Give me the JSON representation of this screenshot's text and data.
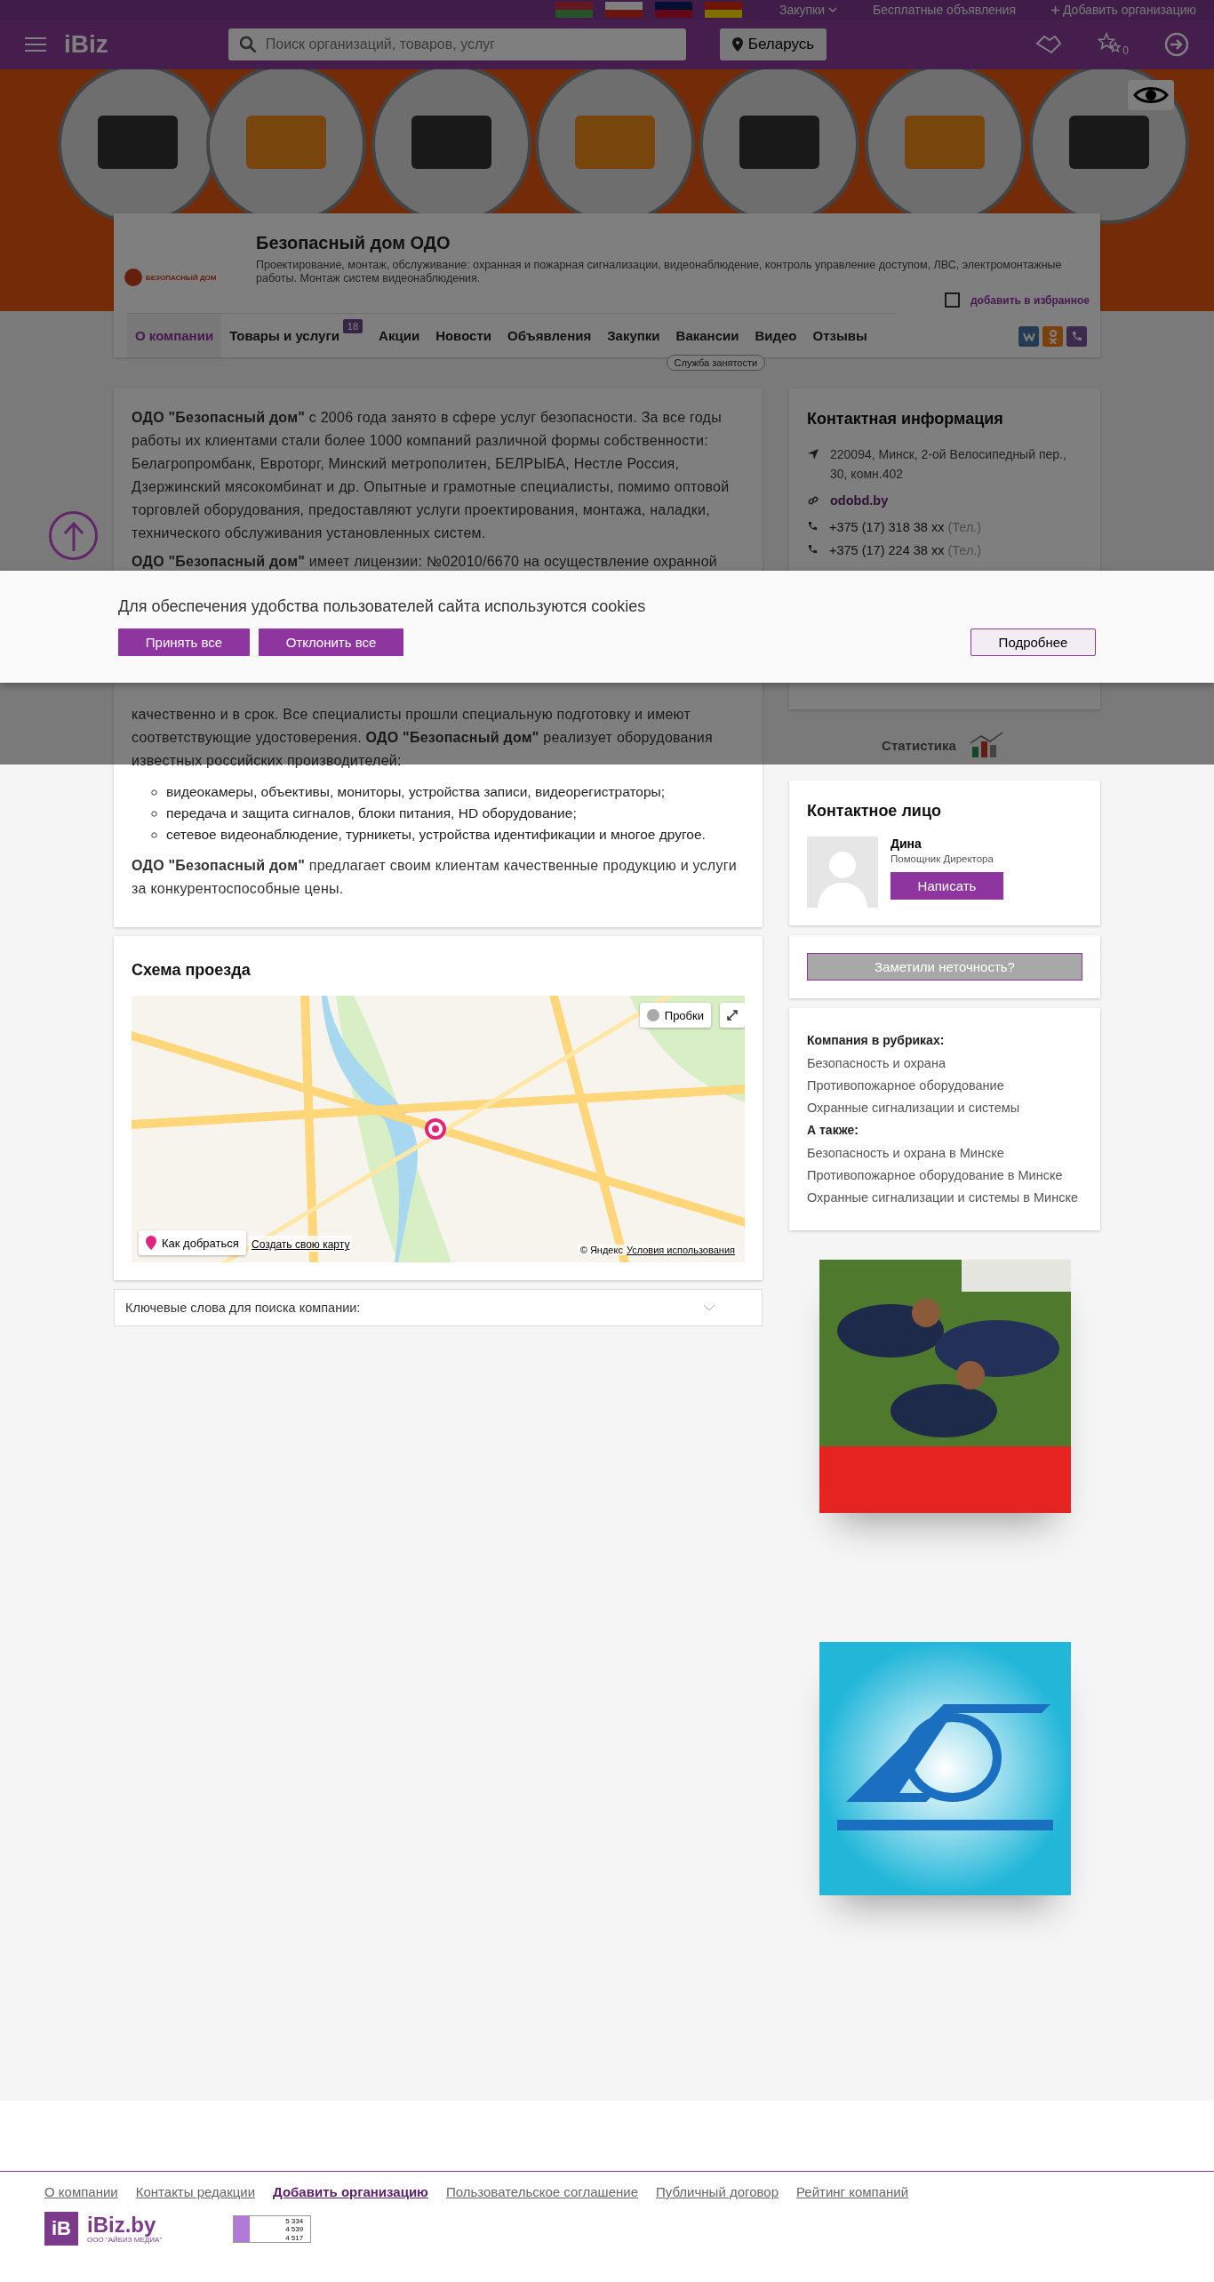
{
  "top_bar": {
    "links": [
      {
        "kind": "dropdown",
        "label": "Закупки"
      },
      {
        "kind": "link",
        "label": "Бесплатные объявления"
      },
      {
        "kind": "add",
        "label": "Добавить организацию"
      }
    ]
  },
  "header": {
    "logo": "iBiz",
    "search": {
      "placeholder": "Поиск организаций, товаров, услуг"
    },
    "region": "Беларусь",
    "favorites_count": "0"
  },
  "company": {
    "logo_text": "БЕЗОПАСНЫЙ ДОМ",
    "name": "Безопасный дом ОДО",
    "description": "Проектирование, монтаж, обслуживание: охранная и пожарная сигнализации, видеонаблюдение, контроль управление доступом, ЛВС, электромонтажные работы. Монтаж систем видеонаблюдения.",
    "favorite": {
      "label": "добавить в избранное",
      "checked": false
    },
    "tabs": [
      {
        "label": "О компании",
        "selected": true
      },
      {
        "label": "Товары и услуги",
        "selected": false,
        "badge": "18"
      },
      {
        "label": "Акции",
        "selected": false
      },
      {
        "label": "Новости",
        "selected": false
      },
      {
        "label": "Объявления",
        "selected": false
      },
      {
        "label": "Закупки",
        "selected": false
      },
      {
        "label": "Вакансии",
        "selected": false,
        "tooltip": "Служба занятости"
      },
      {
        "label": "Видео",
        "selected": false
      },
      {
        "label": "Отзывы",
        "selected": false
      }
    ]
  },
  "about": [
    {
      "kind": "paragraph",
      "text": "**ОДО \"Безопасный дом\"**  с 2006 года занято в сфере услуг безопасности. За все годы работы  их клиентами  стали более 1000 компаний различной формы собственности: Белагропромбанк, Евроторг, Минский метрополитен, БЕЛРЫБА, Нестле Россия, Дзержинский мясокомбинат и др. Опытные и грамотные специалисты, помимо оптовой торговлей оборудования, предоставляют услуги проектирования, монтажа, наладки, технического обслуживания установленных систем."
    },
    {
      "kind": "covered",
      "text": "**ОДО \"Безопасный дом\"** имеет лицензии: №02010/6670 на осуществление охранной"
    },
    {
      "kind": "paragraph",
      "text": "качественно и в срок.  Все специалисты прошли специальную подготовку и имеют соответствующие удостоверения.  **ОДО \"Безопасный дом\"** реализует оборудования известных российских производителей:"
    },
    {
      "kind": "list",
      "items": [
        "видеокамеры, объективы, мониторы, устройства записи, видеорегистраторы;",
        "передача и защита сигналов, блоки питания, HD оборудование;",
        "сетевое видеонаблюдение, турникеты, устройства идентификации и многое другое."
      ]
    },
    {
      "kind": "paragraph",
      "text": "**ОДО \"Безопасный дом\"** предлагает своим клиентам качественные продукцию и услуги за конкурентоспособные цены."
    }
  ],
  "map": {
    "title": "Схема проезда",
    "traffic_button": "Пробки",
    "route_button": "Как добраться",
    "create_link": "Создать свою карту",
    "copyright": "© Яндекс",
    "terms_link": "Условия использования"
  },
  "keywords": {
    "label": "Ключевые слова для поиска компании:",
    "expanded": false
  },
  "contact_info": {
    "title": "Контактная информация",
    "address": "220094, Минск, 2-ой Велосипедный пер., 30, комн.402",
    "website": "odobd.by",
    "phones": [
      {
        "number": "+375 (17) 318 38 xx",
        "type": "(Тел.)"
      },
      {
        "number": "+375 (17) 224 38 xx",
        "type": "(Тел.)"
      }
    ]
  },
  "statistics": "Статистика",
  "contact_person": {
    "title": "Контактное лицо",
    "name": "Дина",
    "position": "Помощник Директора",
    "button": "Написать"
  },
  "report_button": "Заметили неточность?",
  "rubrics": {
    "heading": "Компания в рубриках:",
    "items": [
      "Безопасность и охрана",
      "Противопожарное оборудование",
      "Охранные сигнализации и системы"
    ],
    "also_heading": "А также:",
    "also_items": [
      "Безопасность и охрана в Минске",
      "Противопожарное оборудование в Минске",
      "Охранные сигнализации и системы в Минске"
    ]
  },
  "cookie": {
    "text": "Для обеспечения удобства пользователей сайта используются cookies",
    "accept": "Принять все",
    "decline": "Отклонить все",
    "more": "Подробнее"
  },
  "footer": {
    "links": [
      {
        "label": "О компании",
        "bold": false
      },
      {
        "label": "Контакты редакции",
        "bold": false
      },
      {
        "label": "Добавить организацию",
        "bold": true
      },
      {
        "label": "Пользовательское соглашение",
        "bold": false
      },
      {
        "label": "Публичный договор",
        "bold": false
      },
      {
        "label": "Рейтинг компаний",
        "bold": false
      }
    ],
    "logo_mark": "iB",
    "logo": "iBiz.by",
    "logo_subtitle": "ООО \"АЙБИЗ МЕДИА\"",
    "counter": [
      "5 334",
      "4 539",
      "4 517"
    ]
  }
}
